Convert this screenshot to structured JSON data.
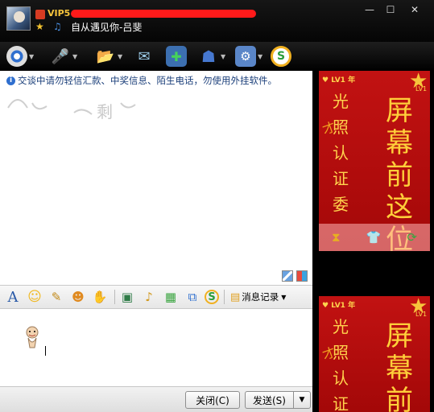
{
  "window": {
    "vip_label": "VIP5",
    "signature": "自从遇见你-吕斐",
    "min_glyph": "—",
    "max_glyph": "☐",
    "close_glyph": "✕"
  },
  "toolbar": [
    {
      "name": "video-icon",
      "glyph": "◉",
      "color": "#d8d8d8"
    },
    {
      "name": "voice-icon",
      "glyph": "🎤",
      "color": "#3a7ce0"
    },
    {
      "name": "file-transfer-icon",
      "glyph": "📂",
      "color": "#f0c040"
    },
    {
      "name": "email-icon",
      "glyph": "✉",
      "color": "#9ccbe8"
    },
    {
      "name": "add-icon",
      "glyph": "✚",
      "color": "#3cb24b"
    },
    {
      "name": "user-card-icon",
      "glyph": "☗",
      "color": "#4678d0"
    },
    {
      "name": "app-icon",
      "glyph": "⚙",
      "color": "#7aa7e8"
    },
    {
      "name": "soso-icon",
      "glyph": "S",
      "color": "#2b9d3a"
    }
  ],
  "chat": {
    "warning": "交谈中请勿轻信汇款、中奖信息、陌生电话，勿使用外挂软件。",
    "watermark": "剩"
  },
  "format_toolbar": {
    "font_glyph": "A",
    "history_label": "消息记录"
  },
  "buttons": {
    "close_label": "关闭(C)",
    "send_label": "发送(S)",
    "send_dropdown_glyph": "▼"
  },
  "ads": {
    "level_text": "LV1",
    "year_text": "年",
    "level_right": "LV1",
    "col1": "光照认证委",
    "col2": "屏幕前这位",
    "col1_b": "光照认证",
    "col2_b": "屏幕前"
  },
  "colors": {
    "ad_red": "#c21212",
    "ad_gold": "#ffd34d"
  }
}
